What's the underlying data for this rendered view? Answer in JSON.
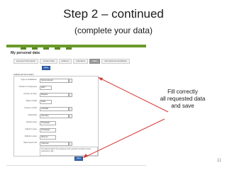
{
  "slide": {
    "title": "Step 2 – continued",
    "subtitle": "(complete your data)",
    "annotation_lines": [
      "Fill correctly",
      "all requested data",
      "and save"
    ],
    "page_number": "11"
  },
  "screen": {
    "page_title": "My personal data",
    "top_nav": [
      "",
      "",
      "",
      "",
      ""
    ],
    "user_links": "",
    "tabs": [
      "personal information",
      "contact data",
      "address",
      "education",
      "other",
      "international candidates"
    ],
    "active_tab": 4,
    "save_label": "Save",
    "section_label": "Additional information",
    "fields": [
      {
        "label": "Type of candidature",
        "value": "Self-employed",
        "dropdown": true
      },
      {
        "label": "Number of employees",
        "value": "2007",
        "dropdown": false
      },
      {
        "label": "Country of issue",
        "value": "Bulgaria",
        "dropdown": true
      },
      {
        "label": "Place of birth",
        "value": "Sofia",
        "dropdown": false
      },
      {
        "label": "Country of birth",
        "value": "Australia",
        "dropdown": true
      },
      {
        "label": "Citizenship",
        "value": "Germany",
        "dropdown": true
      },
      {
        "label": "Family name",
        "value": "Purdopaev",
        "dropdown": false
      },
      {
        "label": "Father's name",
        "value": "Purdopaev",
        "dropdown": false
      },
      {
        "label": "Mother's name",
        "value": "Nina Ivo",
        "dropdown": false
      },
      {
        "label": "Most recent role",
        "value": "Unknown",
        "dropdown": true
      }
    ],
    "disclaimer": "The data is held for the purposes of the selection procedure and is protected by law."
  },
  "colors": {
    "header_green": "#6a9a2a",
    "button_blue": "#3a6bb5",
    "arrow_red": "#d63a3a"
  }
}
